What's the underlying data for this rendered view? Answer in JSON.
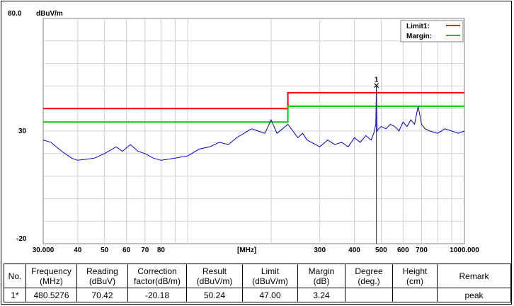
{
  "chart_data": {
    "type": "line",
    "x_scale": "log",
    "xlim": [
      30,
      1000
    ],
    "ylim": [
      -20,
      80
    ],
    "unit_label": "dBuV/m",
    "y_top_label": "80.0",
    "y_mid_label": "30",
    "y_bottom_label": "-20",
    "x_unit_label": "[MHz]",
    "x_tick_labels": [
      {
        "value": 30,
        "label": "30.000"
      },
      {
        "value": 40,
        "label": "40"
      },
      {
        "value": 50,
        "label": "50"
      },
      {
        "value": 60,
        "label": "60"
      },
      {
        "value": 70,
        "label": "70"
      },
      {
        "value": 80,
        "label": "80"
      },
      {
        "value": 300,
        "label": "300"
      },
      {
        "value": 400,
        "label": "400"
      },
      {
        "value": 500,
        "label": "500"
      },
      {
        "value": 600,
        "label": "600"
      },
      {
        "value": 700,
        "label": "700"
      },
      {
        "value": 1000,
        "label": "1000.000"
      }
    ],
    "grid": true,
    "legend_position": "top-right",
    "series": [
      {
        "name": "Limit1:",
        "color": "#ff0000",
        "x": [
          30,
          230,
          230,
          1000
        ],
        "y": [
          40,
          40,
          47,
          47
        ]
      },
      {
        "name": "Margin:",
        "color": "#00cc00",
        "x": [
          30,
          230,
          230,
          1000
        ],
        "y": [
          34,
          34,
          41,
          41
        ]
      },
      {
        "name": "",
        "color": "#0000cc",
        "x": [
          30,
          32,
          35,
          38,
          40,
          43,
          46,
          50,
          55,
          58,
          62,
          66,
          70,
          75,
          80,
          90,
          100,
          110,
          120,
          130,
          140,
          150,
          170,
          190,
          200,
          210,
          220,
          230,
          240,
          250,
          260,
          270,
          280,
          300,
          320,
          340,
          360,
          380,
          400,
          420,
          440,
          460,
          470,
          478,
          480.5,
          483,
          490,
          500,
          520,
          540,
          560,
          580,
          600,
          620,
          640,
          660,
          680,
          690,
          700,
          720,
          750,
          800,
          850,
          900,
          950,
          1000
        ],
        "y": [
          26,
          25,
          21,
          18,
          17,
          17.5,
          18,
          20,
          23,
          21,
          24,
          21,
          20,
          18,
          17,
          18,
          19,
          22,
          23,
          25,
          24,
          27,
          31,
          29,
          35,
          29,
          31,
          33,
          30,
          27,
          29,
          26,
          25,
          23,
          26,
          24,
          25,
          23,
          27,
          25,
          28,
          26,
          29,
          33,
          50,
          30,
          31,
          32,
          31,
          33,
          32,
          30,
          34,
          32,
          35,
          33,
          41,
          37,
          33,
          31,
          30,
          29,
          31,
          30,
          29,
          30
        ]
      }
    ],
    "marker": {
      "label": "1",
      "x": 480.5276,
      "y": 50.24
    }
  },
  "table": {
    "headers": [
      [
        "No.",
        ""
      ],
      [
        "Frequency",
        "(MHz)"
      ],
      [
        "Reading",
        "(dBuV)"
      ],
      [
        "Correction",
        "factor(dB/m)"
      ],
      [
        "Result",
        "(dBuV/m)"
      ],
      [
        "Limit",
        "(dBuV/m)"
      ],
      [
        "Margin",
        "(dB)"
      ],
      [
        "Degree",
        "(deg.)"
      ],
      [
        "Height",
        "(cm)"
      ],
      [
        "Remark",
        ""
      ]
    ],
    "rows": [
      [
        "1*",
        "480.5276",
        "70.42",
        "-20.18",
        "50.24",
        "47.00",
        "3.24",
        "",
        "",
        "peak"
      ]
    ]
  }
}
